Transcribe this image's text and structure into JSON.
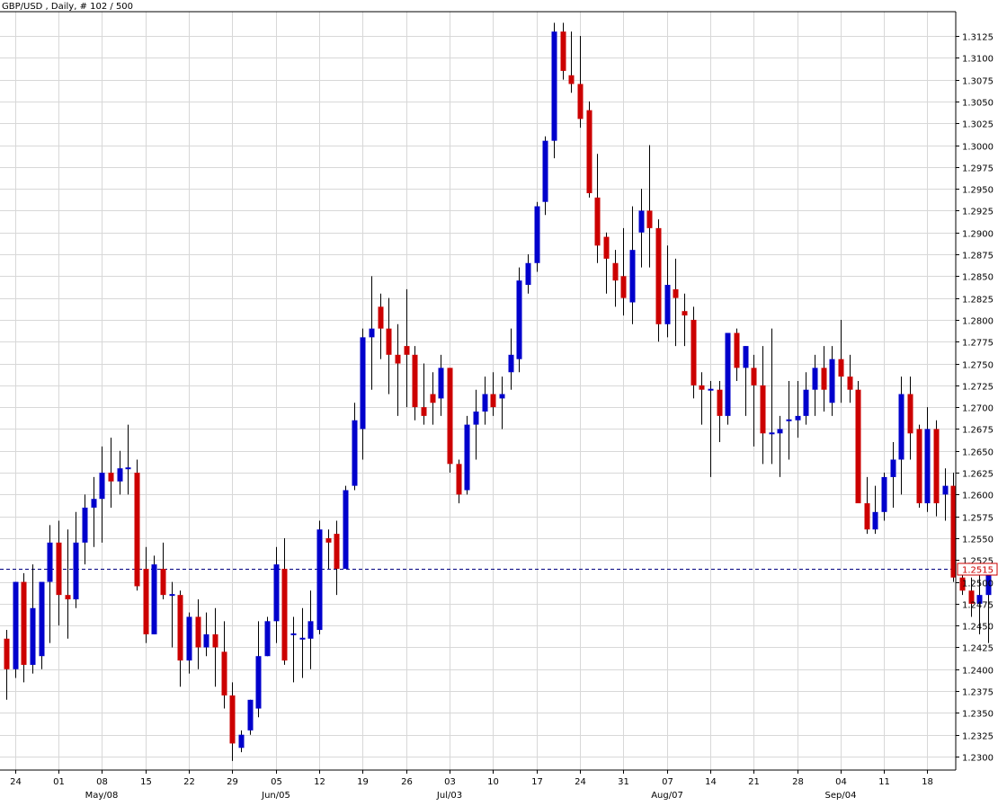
{
  "header": {
    "title": "GBP/USD , Daily, # 102 / 500"
  },
  "colors": {
    "up": "#0000cc",
    "down": "#cc0000",
    "wick": "#000000",
    "grid": "#d8d8d8",
    "axis": "#000000",
    "price_line": "#000080",
    "price_label_border": "#cc0000",
    "price_label_text": "#cc0000"
  },
  "chart_data": {
    "type": "candlestick",
    "title": "GBP/USD , Daily, # 102 / 500",
    "ylim": [
      1.2285,
      1.315
    ],
    "y_ticks": [
      "1.3125",
      "1.3100",
      "1.3075",
      "1.3050",
      "1.3025",
      "1.3000",
      "1.2975",
      "1.2950",
      "1.2925",
      "1.2900",
      "1.2875",
      "1.2850",
      "1.2825",
      "1.2800",
      "1.2775",
      "1.2750",
      "1.2725",
      "1.2700",
      "1.2675",
      "1.2650",
      "1.2625",
      "1.2600",
      "1.2575",
      "1.2550",
      "1.2525",
      "1.2500",
      "1.2475",
      "1.2450",
      "1.2425",
      "1.2400",
      "1.2375",
      "1.2350",
      "1.2325",
      "1.2300"
    ],
    "x_day_labels": [
      {
        "index": 1,
        "label": "24"
      },
      {
        "index": 6,
        "label": "01"
      },
      {
        "index": 11,
        "label": "08"
      },
      {
        "index": 16,
        "label": "15"
      },
      {
        "index": 21,
        "label": "22"
      },
      {
        "index": 26,
        "label": "29"
      },
      {
        "index": 31,
        "label": "05"
      },
      {
        "index": 36,
        "label": "12"
      },
      {
        "index": 41,
        "label": "19"
      },
      {
        "index": 46,
        "label": "26"
      },
      {
        "index": 51,
        "label": "03"
      },
      {
        "index": 56,
        "label": "10"
      },
      {
        "index": 61,
        "label": "17"
      },
      {
        "index": 66,
        "label": "24"
      },
      {
        "index": 71,
        "label": "31"
      },
      {
        "index": 76,
        "label": "07"
      },
      {
        "index": 81,
        "label": "14"
      },
      {
        "index": 86,
        "label": "21"
      },
      {
        "index": 91,
        "label": "28"
      },
      {
        "index": 96,
        "label": "04"
      },
      {
        "index": 101,
        "label": "11"
      },
      {
        "index": 106,
        "label": "18"
      }
    ],
    "x_month_labels": [
      {
        "index": 11,
        "label": "May/08"
      },
      {
        "index": 31,
        "label": "Jun/05"
      },
      {
        "index": 51,
        "label": "Jul/03"
      },
      {
        "index": 76,
        "label": "Aug/07"
      },
      {
        "index": 96,
        "label": "Sep/04"
      }
    ],
    "current_price": "1.2515",
    "candles": [
      [
        1.2435,
        1.2445,
        1.2365,
        1.24
      ],
      [
        1.24,
        1.25,
        1.239,
        1.25
      ],
      [
        1.25,
        1.251,
        1.2385,
        1.2405
      ],
      [
        1.2405,
        1.252,
        1.2395,
        1.247
      ],
      [
        1.2415,
        1.2495,
        1.24,
        1.25
      ],
      [
        1.25,
        1.2565,
        1.243,
        1.2545
      ],
      [
        1.2545,
        1.257,
        1.245,
        1.2485
      ],
      [
        1.2485,
        1.256,
        1.2435,
        1.248
      ],
      [
        1.248,
        1.258,
        1.247,
        1.2545
      ],
      [
        1.2545,
        1.26,
        1.252,
        1.2585
      ],
      [
        1.2585,
        1.262,
        1.254,
        1.2595
      ],
      [
        1.2595,
        1.2655,
        1.2545,
        1.2625
      ],
      [
        1.2625,
        1.2665,
        1.2585,
        1.2615
      ],
      [
        1.2615,
        1.265,
        1.26,
        1.263
      ],
      [
        1.263,
        1.268,
        1.26,
        1.263
      ],
      [
        1.2625,
        1.264,
        1.249,
        1.2495
      ],
      [
        1.2515,
        1.254,
        1.243,
        1.244
      ],
      [
        1.244,
        1.253,
        1.244,
        1.252
      ],
      [
        1.2515,
        1.2545,
        1.248,
        1.2485
      ],
      [
        1.2485,
        1.25,
        1.2425,
        1.2485
      ],
      [
        1.2485,
        1.249,
        1.238,
        1.241
      ],
      [
        1.241,
        1.2465,
        1.2395,
        1.246
      ],
      [
        1.246,
        1.248,
        1.24,
        1.2425
      ],
      [
        1.2425,
        1.2465,
        1.2415,
        1.244
      ],
      [
        1.244,
        1.247,
        1.238,
        1.2425
      ],
      [
        1.242,
        1.2455,
        1.2355,
        1.237
      ],
      [
        1.237,
        1.2385,
        1.2295,
        1.2315
      ],
      [
        1.231,
        1.233,
        1.2305,
        1.2325
      ],
      [
        1.233,
        1.2365,
        1.2325,
        1.2365
      ],
      [
        1.2355,
        1.2455,
        1.2345,
        1.2415
      ],
      [
        1.2415,
        1.246,
        1.2415,
        1.2455
      ],
      [
        1.2455,
        1.254,
        1.243,
        1.252
      ],
      [
        1.2515,
        1.255,
        1.2405,
        1.241
      ],
      [
        1.244,
        1.246,
        1.2385,
        1.244
      ],
      [
        1.2435,
        1.247,
        1.239,
        1.2435
      ],
      [
        1.2435,
        1.249,
        1.24,
        1.2455
      ],
      [
        1.2445,
        1.257,
        1.244,
        1.256
      ],
      [
        1.255,
        1.256,
        1.2515,
        1.2545
      ],
      [
        1.2555,
        1.257,
        1.2485,
        1.2515
      ],
      [
        1.2515,
        1.261,
        1.2515,
        1.2605
      ],
      [
        1.261,
        1.2705,
        1.2605,
        1.2685
      ],
      [
        1.2675,
        1.279,
        1.264,
        1.278
      ],
      [
        1.278,
        1.285,
        1.272,
        1.279
      ],
      [
        1.2815,
        1.283,
        1.2755,
        1.279
      ],
      [
        1.279,
        1.2825,
        1.2715,
        1.276
      ],
      [
        1.276,
        1.2795,
        1.269,
        1.275
      ],
      [
        1.277,
        1.2835,
        1.27,
        1.276
      ],
      [
        1.276,
        1.277,
        1.2685,
        1.27
      ],
      [
        1.27,
        1.275,
        1.268,
        1.269
      ],
      [
        1.2715,
        1.274,
        1.268,
        1.2705
      ],
      [
        1.271,
        1.276,
        1.269,
        1.2745
      ],
      [
        1.2745,
        1.2745,
        1.2625,
        1.2635
      ],
      [
        1.2635,
        1.264,
        1.259,
        1.26
      ],
      [
        1.2605,
        1.269,
        1.26,
        1.268
      ],
      [
        1.268,
        1.272,
        1.264,
        1.2695
      ],
      [
        1.2695,
        1.2735,
        1.268,
        1.2715
      ],
      [
        1.2715,
        1.274,
        1.269,
        1.27
      ],
      [
        1.271,
        1.2735,
        1.2675,
        1.2715
      ],
      [
        1.274,
        1.279,
        1.272,
        1.276
      ],
      [
        1.2755,
        1.286,
        1.274,
        1.2845
      ],
      [
        1.284,
        1.2875,
        1.283,
        1.2865
      ],
      [
        1.2865,
        1.2935,
        1.2855,
        1.293
      ],
      [
        1.2935,
        1.301,
        1.292,
        1.3005
      ],
      [
        1.3005,
        1.314,
        1.2985,
        1.313
      ],
      [
        1.313,
        1.314,
        1.3075,
        1.3085
      ],
      [
        1.308,
        1.313,
        1.306,
        1.307
      ],
      [
        1.307,
        1.3125,
        1.302,
        1.303
      ],
      [
        1.304,
        1.305,
        1.294,
        1.2945
      ],
      [
        1.294,
        1.299,
        1.2865,
        1.2885
      ],
      [
        1.2895,
        1.29,
        1.283,
        1.287
      ],
      [
        1.2865,
        1.288,
        1.2815,
        1.2845
      ],
      [
        1.285,
        1.2905,
        1.2805,
        1.2825
      ],
      [
        1.282,
        1.293,
        1.2795,
        1.288
      ],
      [
        1.29,
        1.295,
        1.286,
        1.2925
      ],
      [
        1.2925,
        1.3,
        1.286,
        1.2905
      ],
      [
        1.2905,
        1.2915,
        1.2775,
        1.2795
      ],
      [
        1.2795,
        1.2885,
        1.278,
        1.284
      ],
      [
        1.2835,
        1.287,
        1.277,
        1.2825
      ],
      [
        1.281,
        1.283,
        1.277,
        1.2805
      ],
      [
        1.28,
        1.2815,
        1.271,
        1.2725
      ],
      [
        1.2725,
        1.274,
        1.268,
        1.272
      ],
      [
        1.272,
        1.273,
        1.262,
        1.272
      ],
      [
        1.272,
        1.273,
        1.266,
        1.269
      ],
      [
        1.269,
        1.2785,
        1.268,
        1.2785
      ],
      [
        1.2785,
        1.279,
        1.273,
        1.2745
      ],
      [
        1.2745,
        1.277,
        1.269,
        1.277
      ],
      [
        1.2745,
        1.276,
        1.2655,
        1.2725
      ],
      [
        1.2725,
        1.277,
        1.2635,
        1.267
      ],
      [
        1.267,
        1.279,
        1.2635,
        1.267
      ],
      [
        1.267,
        1.269,
        1.262,
        1.2675
      ],
      [
        1.2685,
        1.273,
        1.264,
        1.2685
      ],
      [
        1.2685,
        1.273,
        1.2665,
        1.269
      ],
      [
        1.269,
        1.274,
        1.268,
        1.272
      ],
      [
        1.272,
        1.276,
        1.269,
        1.2745
      ],
      [
        1.2745,
        1.277,
        1.2695,
        1.272
      ],
      [
        1.2705,
        1.277,
        1.269,
        1.2755
      ],
      [
        1.2755,
        1.28,
        1.2705,
        1.2735
      ],
      [
        1.2735,
        1.276,
        1.2705,
        1.272
      ],
      [
        1.272,
        1.273,
        1.262,
        1.259
      ],
      [
        1.259,
        1.262,
        1.2555,
        1.256
      ],
      [
        1.256,
        1.261,
        1.2555,
        1.258
      ],
      [
        1.258,
        1.2625,
        1.257,
        1.262
      ],
      [
        1.262,
        1.266,
        1.2585,
        1.264
      ],
      [
        1.264,
        1.2735,
        1.26,
        1.2715
      ],
      [
        1.2715,
        1.2735,
        1.264,
        1.267
      ],
      [
        1.2675,
        1.268,
        1.2585,
        1.259
      ],
      [
        1.259,
        1.27,
        1.258,
        1.2675
      ],
      [
        1.2675,
        1.2685,
        1.2575,
        1.259
      ],
      [
        1.26,
        1.263,
        1.257,
        1.261
      ],
      [
        1.261,
        1.2625,
        1.25,
        1.2505
      ],
      [
        1.2505,
        1.252,
        1.2485,
        1.249
      ],
      [
        1.249,
        1.2505,
        1.246,
        1.2475
      ],
      [
        1.2475,
        1.252,
        1.244,
        1.2485
      ],
      [
        1.2485,
        1.2515,
        1.243,
        1.2515
      ]
    ]
  }
}
